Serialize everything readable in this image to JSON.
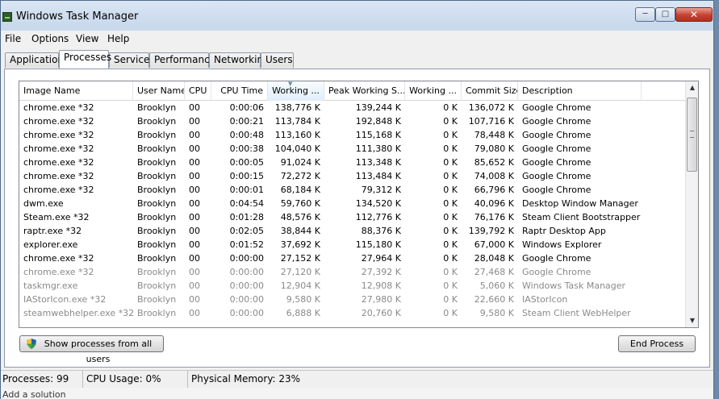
{
  "window": {
    "title": "Windows Task Manager"
  },
  "menubar": [
    "File",
    "Options",
    "View",
    "Help"
  ],
  "tabs": [
    "Applications",
    "Processes",
    "Services",
    "Performance",
    "Networking",
    "Users"
  ],
  "active_tab": "Processes",
  "columns": [
    "Image Name",
    "User Name",
    "CPU",
    "CPU Time",
    "Working ...",
    "Peak Working S...",
    "Working ...",
    "Commit Size",
    "Description"
  ],
  "sorted_column": "Working ...",
  "rows": [
    {
      "name": "chrome.exe *32",
      "user": "Brooklyn",
      "cpu": "00",
      "cpu_time": "0:00:06",
      "ws": "138,776 K",
      "peak": "139,244 K",
      "wsd": "0 K",
      "commit": "136,072 K",
      "desc": "Google Chrome"
    },
    {
      "name": "chrome.exe *32",
      "user": "Brooklyn",
      "cpu": "00",
      "cpu_time": "0:00:21",
      "ws": "113,784 K",
      "peak": "192,848 K",
      "wsd": "0 K",
      "commit": "107,716 K",
      "desc": "Google Chrome"
    },
    {
      "name": "chrome.exe *32",
      "user": "Brooklyn",
      "cpu": "00",
      "cpu_time": "0:00:48",
      "ws": "113,160 K",
      "peak": "115,168 K",
      "wsd": "0 K",
      "commit": "78,448 K",
      "desc": "Google Chrome"
    },
    {
      "name": "chrome.exe *32",
      "user": "Brooklyn",
      "cpu": "00",
      "cpu_time": "0:00:38",
      "ws": "104,040 K",
      "peak": "111,380 K",
      "wsd": "0 K",
      "commit": "79,080 K",
      "desc": "Google Chrome"
    },
    {
      "name": "chrome.exe *32",
      "user": "Brooklyn",
      "cpu": "00",
      "cpu_time": "0:00:05",
      "ws": "91,024 K",
      "peak": "113,348 K",
      "wsd": "0 K",
      "commit": "85,652 K",
      "desc": "Google Chrome"
    },
    {
      "name": "chrome.exe *32",
      "user": "Brooklyn",
      "cpu": "00",
      "cpu_time": "0:00:15",
      "ws": "72,272 K",
      "peak": "113,484 K",
      "wsd": "0 K",
      "commit": "74,008 K",
      "desc": "Google Chrome"
    },
    {
      "name": "chrome.exe *32",
      "user": "Brooklyn",
      "cpu": "00",
      "cpu_time": "0:00:01",
      "ws": "68,184 K",
      "peak": "79,312 K",
      "wsd": "0 K",
      "commit": "66,796 K",
      "desc": "Google Chrome"
    },
    {
      "name": "dwm.exe",
      "user": "Brooklyn",
      "cpu": "00",
      "cpu_time": "0:04:54",
      "ws": "59,760 K",
      "peak": "134,520 K",
      "wsd": "0 K",
      "commit": "40,096 K",
      "desc": "Desktop Window Manager"
    },
    {
      "name": "Steam.exe *32",
      "user": "Brooklyn",
      "cpu": "00",
      "cpu_time": "0:01:28",
      "ws": "48,576 K",
      "peak": "112,776 K",
      "wsd": "0 K",
      "commit": "76,176 K",
      "desc": "Steam Client Bootstrapper"
    },
    {
      "name": "raptr.exe *32",
      "user": "Brooklyn",
      "cpu": "00",
      "cpu_time": "0:02:05",
      "ws": "38,844 K",
      "peak": "88,376 K",
      "wsd": "0 K",
      "commit": "139,792 K",
      "desc": "Raptr Desktop App"
    },
    {
      "name": "explorer.exe",
      "user": "Brooklyn",
      "cpu": "00",
      "cpu_time": "0:01:52",
      "ws": "37,692 K",
      "peak": "115,180 K",
      "wsd": "0 K",
      "commit": "67,000 K",
      "desc": "Windows Explorer"
    },
    {
      "name": "chrome.exe *32",
      "user": "Brooklyn",
      "cpu": "00",
      "cpu_time": "0:00:00",
      "ws": "27,152 K",
      "peak": "27,964 K",
      "wsd": "0 K",
      "commit": "28,048 K",
      "desc": "Google Chrome"
    },
    {
      "name": "chrome.exe *32",
      "user": "Brooklyn",
      "cpu": "00",
      "cpu_time": "0:00:00",
      "ws": "27,120 K",
      "peak": "27,392 K",
      "wsd": "0 K",
      "commit": "27,468 K",
      "desc": "Google Chrome"
    },
    {
      "name": "taskmgr.exe",
      "user": "Brooklyn",
      "cpu": "00",
      "cpu_time": "0:00:00",
      "ws": "12,904 K",
      "peak": "12,908 K",
      "wsd": "0 K",
      "commit": "5,060 K",
      "desc": "Windows Task Manager"
    },
    {
      "name": "IAStorIcon.exe *32",
      "user": "Brooklyn",
      "cpu": "00",
      "cpu_time": "0:00:00",
      "ws": "9,580 K",
      "peak": "27,980 K",
      "wsd": "0 K",
      "commit": "22,660 K",
      "desc": "IAStorIcon"
    },
    {
      "name": "steamwebhelper.exe *32",
      "user": "Brooklyn",
      "cpu": "00",
      "cpu_time": "0:00:00",
      "ws": "6,888 K",
      "peak": "20,760 K",
      "wsd": "0 K",
      "commit": "9,580 K",
      "desc": "Steam Client WebHelper"
    }
  ],
  "buttons": {
    "show_all": "Show processes from all users",
    "end_process": "End Process"
  },
  "status": {
    "processes": "Processes: 99",
    "cpu_usage": "CPU Usage: 0%",
    "physical_memory": "Physical Memory: 23%"
  },
  "background_text": "Add a solution",
  "colors": {
    "dim_text": "#8a8a8a",
    "close_red": "#c7412f",
    "frame": "#c9d9ec"
  }
}
